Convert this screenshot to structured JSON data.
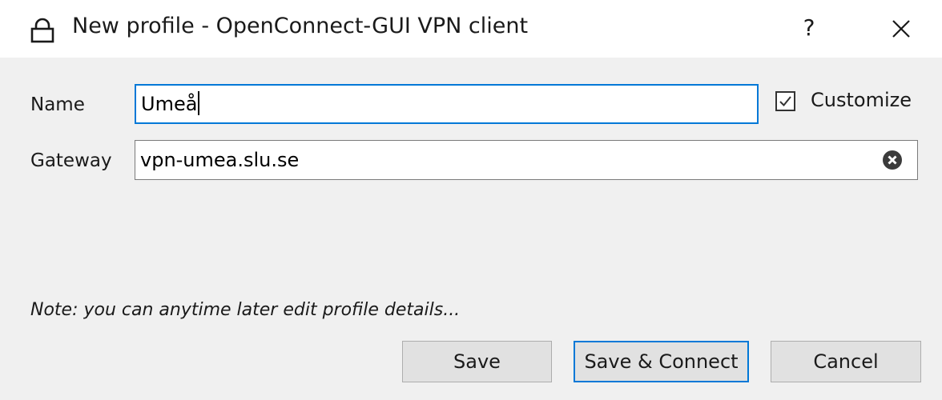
{
  "window": {
    "title": "New profile - OpenConnect-GUI VPN client",
    "icon": "lock-icon",
    "help_label": "?",
    "close_icon": "close-icon"
  },
  "form": {
    "name_label": "Name",
    "name_value": "Umeå",
    "gateway_label": "Gateway",
    "gateway_value": "vpn-umea.slu.se",
    "gateway_clear_icon": "clear-icon",
    "customize_label": "Customize",
    "customize_checked": true
  },
  "note": "Note: you can anytime later edit profile details...",
  "buttons": {
    "save": "Save",
    "save_connect": "Save & Connect",
    "cancel": "Cancel"
  },
  "colors": {
    "accent": "#0078d7",
    "client_background": "#f0f0f0",
    "button_background": "#e1e1e1"
  }
}
